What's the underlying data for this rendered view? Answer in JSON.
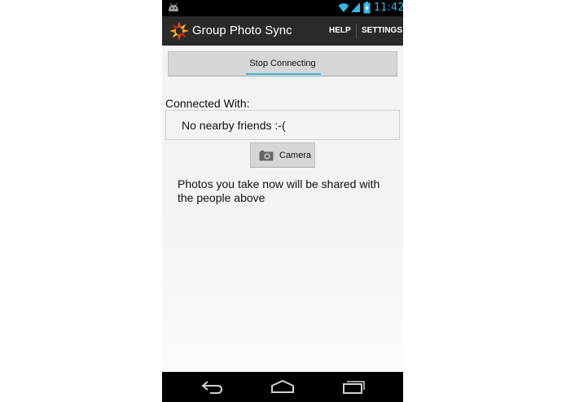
{
  "status_bar": {
    "time": "11:42",
    "icons": [
      "android-icon",
      "wifi-icon",
      "signal-icon",
      "battery-icon"
    ]
  },
  "action_bar": {
    "title": "Group Photo Sync",
    "help_label": "HELP",
    "settings_label": "SETTINGS",
    "logo": "starburst-logo-icon"
  },
  "main": {
    "stop_label": "Stop Connecting",
    "connected_label": "Connected With:",
    "friends_empty": "No nearby friends :-(",
    "camera_label": "Camera",
    "camera_icon": "camera-icon",
    "info_text": "Photos you take now will be shared with the people above"
  },
  "nav_bar": {
    "items": [
      "back-icon",
      "home-icon",
      "recent-apps-icon"
    ]
  },
  "colors": {
    "accent": "#33b5e5",
    "action_bar": "#2a2a2a",
    "background": "#f3f3f3",
    "button": "#d6d6d6"
  }
}
